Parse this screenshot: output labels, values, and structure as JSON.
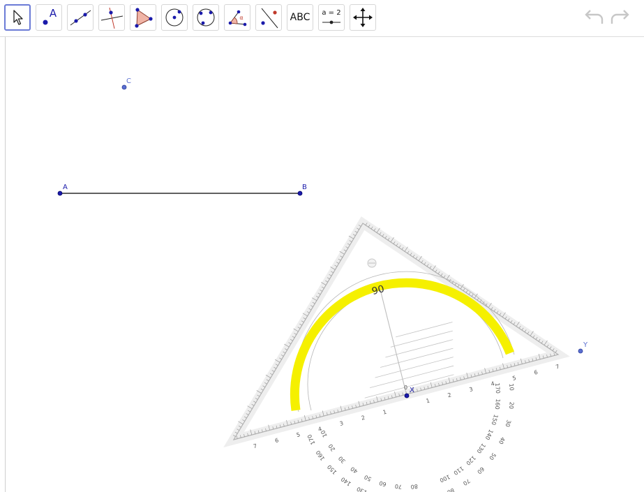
{
  "toolbar": {
    "tools": [
      {
        "id": "move",
        "name": "Move",
        "selected": true,
        "icon": "cursor-arrow-icon"
      },
      {
        "id": "point",
        "name": "Point",
        "label": "A",
        "icon": "point-icon"
      },
      {
        "id": "line",
        "name": "Line",
        "icon": "line-icon"
      },
      {
        "id": "perpendicular",
        "name": "Perpendicular Line",
        "icon": "perpendicular-line-icon"
      },
      {
        "id": "polygon",
        "name": "Polygon",
        "icon": "polygon-icon"
      },
      {
        "id": "circle",
        "name": "Circle with Center",
        "icon": "circle-center-icon"
      },
      {
        "id": "ellipse",
        "name": "Circle through 3 points",
        "icon": "circle-three-points-icon"
      },
      {
        "id": "angle",
        "name": "Angle",
        "label": "α",
        "icon": "angle-icon"
      },
      {
        "id": "reflect",
        "name": "Reflect about Line",
        "icon": "reflect-icon"
      },
      {
        "id": "text",
        "name": "Text",
        "label": "ABC",
        "icon": "text-icon"
      },
      {
        "id": "slider",
        "name": "Slider",
        "label": "a = 2",
        "icon": "slider-icon"
      },
      {
        "id": "move-view",
        "name": "Move Graphics View",
        "icon": "move-view-icon"
      }
    ],
    "undo_icon": "undo-icon",
    "redo_icon": "redo-icon"
  },
  "canvas": {
    "points": [
      {
        "name": "C",
        "label": "C"
      },
      {
        "name": "A",
        "label": "A"
      },
      {
        "name": "B",
        "label": "B"
      },
      {
        "name": "X",
        "label": "X"
      },
      {
        "name": "Y",
        "label": "Y"
      }
    ],
    "segment": {
      "from": "A",
      "to": "B"
    },
    "set_square": {
      "highlight_color": "#f5f000",
      "center_label": "90",
      "outer_degrees": [
        "10",
        "20",
        "30",
        "40",
        "50",
        "60",
        "70",
        "80",
        "100",
        "110",
        "120",
        "130",
        "140",
        "150",
        "160",
        "170"
      ],
      "inner_degrees": [
        "170",
        "160",
        "150",
        "140",
        "130",
        "120",
        "110",
        "100",
        "80",
        "70",
        "60",
        "50",
        "40",
        "30",
        "20",
        "10"
      ],
      "zero_label": "0",
      "ruler_numbers": [
        "1",
        "2",
        "3",
        "4",
        "5",
        "6",
        "7"
      ]
    },
    "colors": {
      "point_blue": "#1a1aaa",
      "point_light": "#5a6fd0",
      "line": "#000000",
      "ruler_gray": "#9a9a9a"
    }
  }
}
